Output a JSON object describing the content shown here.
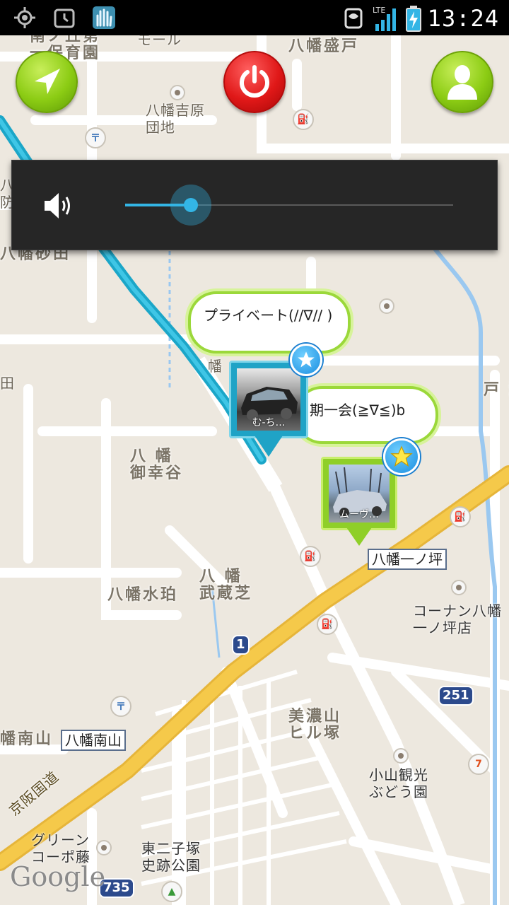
{
  "status_bar": {
    "time": "13:24",
    "network": "LTE",
    "icons": [
      "gps-icon",
      "alarm-icon",
      "app-hand-icon",
      "vibrate-icon",
      "signal-icon",
      "battery-charging-icon"
    ]
  },
  "buttons": {
    "navigate": "navigation-arrow-icon",
    "power": "power-icon",
    "profile": "person-icon"
  },
  "volume": {
    "icon": "speaker-icon",
    "level": 0.2
  },
  "map": {
    "labels": {
      "hoikuen": "南ノ丘第\n一保育園",
      "mall": "モール",
      "seido": "八幡盛戸",
      "yoshiwara": "八幡吉原\n団地",
      "sunada": "八幡砂田",
      "hachiman_left": "八\n防",
      "miyukidani": "八 幡\n御幸谷",
      "suihaku": "八幡水珀",
      "musashi": "八 幡\n武蔵芝",
      "konan": "コーナン八幡\n一ノ坪店",
      "minoyama": "美濃山\nヒル塚",
      "minami_yama": "幡南山",
      "koyama": "小山観光\nぶどう園",
      "green": "グリーン\nコーポ藤",
      "higashi": "東二子塚\n史跡公園",
      "keihan": "京阪国道",
      "to": "戸 津",
      "ta": "田",
      "hachiman_small": "幡"
    },
    "stations": {
      "ichinotsubo": "八幡一ノ坪",
      "minamiyama": "八幡南山"
    },
    "routes": {
      "r1": "1",
      "r251": "251",
      "r735": "735"
    },
    "google": "Google"
  },
  "posts": [
    {
      "balloon": "プライベート(//∇//\n)",
      "caption": ""
    },
    {
      "balloon": "期一会(≧∇≦)b",
      "caption": "む-ち…"
    },
    {
      "balloon": "",
      "caption": "ムーヴ…"
    }
  ],
  "colors": {
    "accent_blue": "#33b5e5",
    "green_button": "#8ccc14",
    "red_button": "#e01818",
    "highway": "#f5c94a",
    "track": "#1ba6c8"
  }
}
